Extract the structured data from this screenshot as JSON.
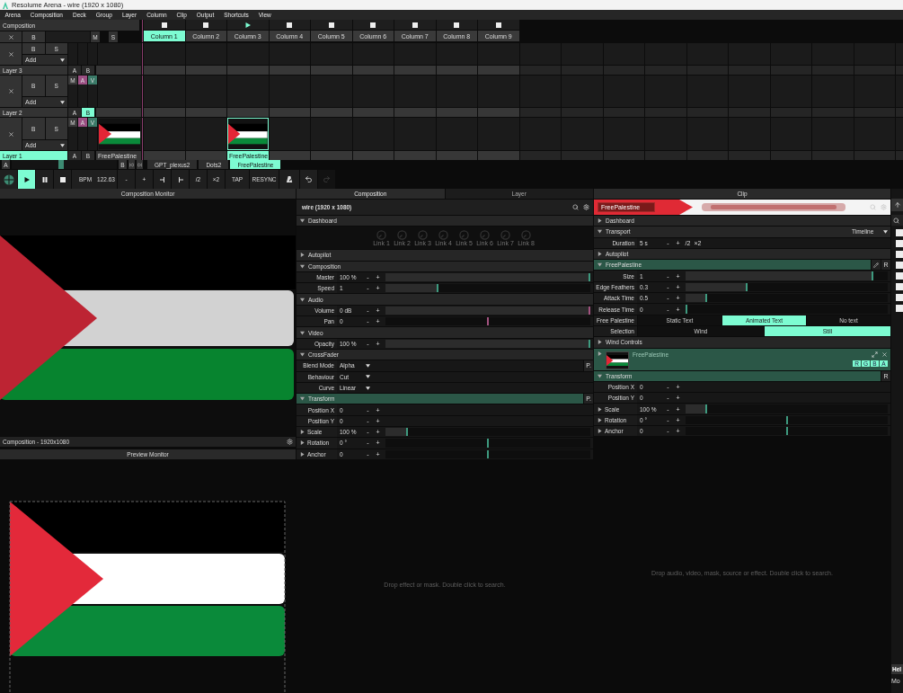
{
  "window": {
    "title": "Resolume Arena - wire (1920 x 1080)"
  },
  "menu": [
    "Arena",
    "Composition",
    "Deck",
    "Group",
    "Layer",
    "Column",
    "Clip",
    "Output",
    "Shortcuts",
    "View"
  ],
  "deck": {
    "composition_label": "Composition",
    "composition_buttons": [
      "B",
      "M",
      "S"
    ],
    "columns": [
      {
        "label": "Column 1",
        "selected": true,
        "playing": false
      },
      {
        "label": "Column 2",
        "selected": false,
        "playing": false
      },
      {
        "label": "Column 3",
        "selected": false,
        "playing": true
      },
      {
        "label": "Column 4",
        "selected": false,
        "playing": false
      },
      {
        "label": "Column 5",
        "selected": false,
        "playing": false
      },
      {
        "label": "Column 6",
        "selected": false,
        "playing": false
      },
      {
        "label": "Column 7",
        "selected": false,
        "playing": false
      },
      {
        "label": "Column 8",
        "selected": false,
        "playing": false
      },
      {
        "label": "Column 9",
        "selected": false,
        "playing": false
      }
    ],
    "layers": [
      {
        "name": "Layer 3",
        "selected": false,
        "buttons": [
          "B",
          "S"
        ],
        "blend": "Add",
        "ab": [
          {
            "label": "A",
            "selected": false
          },
          {
            "label": "B",
            "selected": false
          }
        ],
        "clips": [
          {
            "kind": "empty"
          },
          {
            "kind": "empty"
          },
          {
            "kind": "empty"
          },
          {
            "kind": "empty"
          },
          {
            "kind": "empty"
          },
          {
            "kind": "empty"
          },
          {
            "kind": "empty"
          },
          {
            "kind": "empty"
          },
          {
            "kind": "empty"
          }
        ]
      },
      {
        "name": "Layer 2",
        "selected": false,
        "buttons": [
          "B",
          "S"
        ],
        "blend": "Add",
        "mav": [
          {
            "label": "M",
            "color": "#3a3a3a"
          },
          {
            "label": "A",
            "color": "#9b4f83"
          },
          {
            "label": "V",
            "color": "#3b7a68"
          }
        ],
        "ab": [
          {
            "label": "A",
            "selected": false
          },
          {
            "label": "B",
            "selected": true
          }
        ],
        "clips": [
          {
            "kind": "empty"
          },
          {
            "kind": "empty"
          },
          {
            "kind": "empty"
          },
          {
            "kind": "empty"
          },
          {
            "kind": "empty"
          },
          {
            "kind": "empty"
          },
          {
            "kind": "empty"
          },
          {
            "kind": "empty"
          },
          {
            "kind": "empty"
          }
        ]
      },
      {
        "name": "Layer 1",
        "selected": true,
        "buttons": [
          "B",
          "S"
        ],
        "blend": "Add",
        "mav": [
          {
            "label": "M",
            "color": "#3a3a3a"
          },
          {
            "label": "A",
            "color": "#9b4f83"
          },
          {
            "label": "V",
            "color": "#3b7a68"
          }
        ],
        "ab": [
          {
            "label": "A",
            "selected": false
          },
          {
            "label": "B",
            "selected": false
          }
        ],
        "preview_clip": {
          "name": "FreePalestine"
        },
        "clips": [
          {
            "kind": "empty"
          },
          {
            "kind": "empty"
          },
          {
            "kind": "clip",
            "name": "FreePalestine",
            "selected": true
          },
          {
            "kind": "empty"
          },
          {
            "kind": "empty"
          },
          {
            "kind": "empty"
          },
          {
            "kind": "empty"
          },
          {
            "kind": "empty"
          },
          {
            "kind": "empty"
          }
        ]
      }
    ]
  },
  "deck_bar": {
    "a": "A",
    "b": "B",
    "level": 0.47,
    "decks": [
      {
        "label": "GPT_plexus2",
        "selected": false
      },
      {
        "label": "Dots2",
        "selected": false
      },
      {
        "label": "FreePalestine",
        "selected": true
      }
    ]
  },
  "transport": [
    {
      "kind": "logo"
    },
    {
      "kind": "play",
      "selected": true
    },
    {
      "kind": "pause",
      "selected": false
    },
    {
      "kind": "stop",
      "selected": false
    },
    {
      "kind": "bpm",
      "label": "BPM",
      "value": "122.63"
    },
    {
      "kind": "text",
      "label": "-"
    },
    {
      "kind": "text",
      "label": "+"
    },
    {
      "kind": "nudge_back"
    },
    {
      "kind": "nudge_forward"
    },
    {
      "kind": "text",
      "label": "/2"
    },
    {
      "kind": "text",
      "label": "×2"
    },
    {
      "kind": "text",
      "label": "TAP"
    },
    {
      "kind": "text",
      "label": "RESYNC"
    },
    {
      "kind": "metronome"
    },
    {
      "kind": "undo",
      "disabled": false
    },
    {
      "kind": "redo",
      "disabled": true
    }
  ],
  "monitors": {
    "composition_title": "Composition Monitor",
    "composition_footer": "Composition - 1920x1080",
    "preview_title": "Preview Monitor"
  },
  "composition_panel": {
    "tabs": [
      {
        "label": "Composition",
        "selected": true
      },
      {
        "label": "Layer",
        "selected": false
      }
    ],
    "title": "wire (1920 x 1080)",
    "placeholder": "Drop effect or mask. Double click to search.",
    "items": [
      {
        "kind": "section",
        "label": "Dashboard",
        "expanded": true,
        "active": false
      },
      {
        "kind": "knobs",
        "labels": [
          "Link 1",
          "Link 2",
          "Link 3",
          "Link 4",
          "Link 5",
          "Link 6",
          "Link 7",
          "Link 8"
        ]
      },
      {
        "kind": "section",
        "label": "Autopilot",
        "expanded": false,
        "active": false
      },
      {
        "kind": "section",
        "label": "Composition",
        "expanded": true,
        "active": false
      },
      {
        "kind": "slider",
        "label": "Master",
        "value": "100 %",
        "steps": [
          "-",
          "+"
        ],
        "level": 1,
        "color": "#3e9a7f"
      },
      {
        "kind": "slider",
        "label": "Speed",
        "value": "1",
        "steps": [
          "-",
          "+"
        ],
        "level": 0.25,
        "color": "#3e9a7f"
      },
      {
        "kind": "section",
        "label": "Audio",
        "expanded": true,
        "active": false
      },
      {
        "kind": "slider",
        "label": "Volume",
        "value": "0 dB",
        "steps": [
          "-",
          "+"
        ],
        "level": 1,
        "color": "#a2527f"
      },
      {
        "kind": "centered",
        "label": "Pan",
        "value": "0",
        "steps": [
          "-",
          "+"
        ],
        "level": 0.5,
        "color": "#a2527f"
      },
      {
        "kind": "section",
        "label": "Video",
        "expanded": true,
        "active": false
      },
      {
        "kind": "slider",
        "label": "Opacity",
        "value": "100 %",
        "steps": [
          "-",
          "+"
        ],
        "level": 1,
        "color": "#3e9a7f"
      },
      {
        "kind": "section",
        "label": "CrossFader",
        "expanded": true,
        "active": false
      },
      {
        "kind": "dropdown",
        "label": "Blend Mode",
        "value": "Alpha",
        "button": "P."
      },
      {
        "kind": "dropdown",
        "label": "Behaviour",
        "value": "Cut"
      },
      {
        "kind": "dropdown",
        "label": "Curve",
        "value": "Linear"
      },
      {
        "kind": "section",
        "label": "Transform",
        "expanded": true,
        "active": true,
        "tools": [
          {
            "kind": "text",
            "label": "P."
          }
        ]
      },
      {
        "kind": "value",
        "label": "Position X",
        "value": "0",
        "steps": [
          "-",
          "+"
        ]
      },
      {
        "kind": "value",
        "label": "Position Y",
        "value": "0",
        "steps": [
          "-",
          "+"
        ]
      },
      {
        "kind": "slider",
        "label": "Scale",
        "expanded": false,
        "value": "100 %",
        "steps": [
          "-",
          "+"
        ],
        "level": 0.1,
        "color": "#3e9a7f"
      },
      {
        "kind": "centered",
        "label": "Rotation",
        "expanded": false,
        "value": "0 °",
        "steps": [
          "-",
          "+"
        ],
        "level": 0.5,
        "color": "#3e9a7f"
      },
      {
        "kind": "centered",
        "label": "Anchor",
        "expanded": false,
        "value": "0",
        "steps": [
          "-",
          "+"
        ],
        "level": 0.5,
        "color": "#3e9a7f"
      }
    ]
  },
  "clip_panel": {
    "title": "Clip",
    "name": "FreePalestine",
    "placeholder": "Drop audio, video, mask, source or effect. Double click to search.",
    "items": [
      {
        "kind": "section",
        "label": "Dashboard",
        "expanded": false,
        "active": false
      },
      {
        "kind": "section",
        "label": "Transport",
        "expanded": true,
        "active": false,
        "dropdown": "Timeline"
      },
      {
        "kind": "value",
        "label": "Duration",
        "value": "5 s",
        "steps": [
          "-",
          "+",
          "/2",
          "×2"
        ]
      },
      {
        "kind": "section",
        "label": "Autopilot",
        "expanded": false,
        "active": false
      },
      {
        "kind": "section",
        "label": "FreePalestine",
        "expanded": true,
        "active": true,
        "tools": [
          {
            "kind": "edit"
          },
          {
            "kind": "text",
            "label": "R"
          }
        ]
      },
      {
        "kind": "slider",
        "label": "Size",
        "value": "1",
        "steps": [
          "-",
          "+"
        ],
        "level": 0.93,
        "color": "#3e9a7f"
      },
      {
        "kind": "slider",
        "label": "Edge Feathers",
        "value": "0.3",
        "steps": [
          "-",
          "+"
        ],
        "level": 0.3,
        "color": "#3e9a7f"
      },
      {
        "kind": "slider",
        "label": "Attack Time",
        "value": "0.5",
        "steps": [
          "-",
          "+"
        ],
        "level": 0.1,
        "color": "#3e9a7f"
      },
      {
        "kind": "slider",
        "label": "Release Time",
        "value": "0",
        "steps": [
          "-",
          "+"
        ],
        "level": 0,
        "color": "#3e9a7f"
      },
      {
        "kind": "options",
        "label": "Free Palestine",
        "options": [
          {
            "label": "Static Text",
            "selected": false
          },
          {
            "label": "Animated Text",
            "selected": true
          },
          {
            "label": "No text",
            "selected": false
          }
        ]
      },
      {
        "kind": "options",
        "label": "Selection",
        "options": [
          {
            "label": "Wind",
            "selected": false
          },
          {
            "label": "Still",
            "selected": true
          }
        ]
      },
      {
        "kind": "section",
        "label": "Wind Controls",
        "expanded": false,
        "active": false
      },
      {
        "kind": "source",
        "name": "FreePalestine",
        "expanded": false,
        "channels": [
          {
            "label": "R",
            "on": true
          },
          {
            "label": "G",
            "on": true
          },
          {
            "label": "B",
            "on": true
          },
          {
            "label": "A",
            "on": true
          }
        ]
      },
      {
        "kind": "section",
        "label": "Transform",
        "expanded": true,
        "active": true,
        "tools": [
          {
            "kind": "text",
            "label": "R"
          }
        ]
      },
      {
        "kind": "value",
        "label": "Position X",
        "value": "0",
        "steps": [
          "-",
          "+"
        ]
      },
      {
        "kind": "value",
        "label": "Position Y",
        "value": "0",
        "steps": [
          "-",
          "+"
        ]
      },
      {
        "kind": "slider",
        "label": "Scale",
        "expanded": false,
        "value": "100 %",
        "steps": [
          "-",
          "+"
        ],
        "level": 0.1,
        "color": "#3e9a7f"
      },
      {
        "kind": "centered",
        "label": "Rotation",
        "expanded": false,
        "value": "0 °",
        "steps": [
          "-",
          "+"
        ],
        "level": 0.5,
        "color": "#3e9a7f"
      },
      {
        "kind": "centered",
        "label": "Anchor",
        "expanded": false,
        "value": "0",
        "steps": [
          "-",
          "+"
        ],
        "level": 0.5,
        "color": "#3e9a7f"
      }
    ]
  },
  "side_strip": {
    "checks": [
      {
        "checked": false
      },
      {
        "checked": false
      },
      {
        "checked": false
      },
      {
        "checked": false
      },
      {
        "checked": false
      },
      {
        "checked": false
      },
      {
        "checked": false
      },
      {
        "checked": false
      }
    ],
    "help_title": "Hel",
    "help_text": "Mo"
  }
}
